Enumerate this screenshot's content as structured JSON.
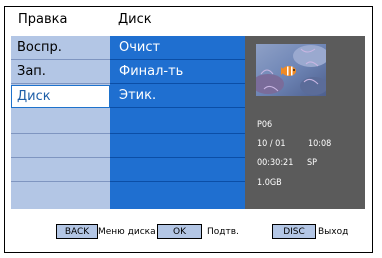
{
  "header": {
    "col1": "Правка",
    "col2": "Диск"
  },
  "left_menu": [
    "Воспр.",
    "Зап.",
    "Диск"
  ],
  "sub_menu": [
    "Очист",
    "Финал-ть",
    "Этик."
  ],
  "disc_info": {
    "title": "P06",
    "date": "10 / 01",
    "time": "10:08",
    "duration": "00:30:21",
    "mode": "SP",
    "size": "1.0GB"
  },
  "footer": {
    "back_btn": "BACK",
    "back_label": "Меню диска",
    "ok_btn": "OK",
    "ok_label": "Подтв.",
    "disc_btn": "DISC",
    "disc_label": "Выход"
  },
  "colors": {
    "left_panel": "#b3c6e5",
    "mid_panel": "#1f6fd0",
    "right_panel": "#5b5b5b",
    "selection_border": "#1e72cc"
  },
  "icons": {
    "thumbnail": "coral-reef-fish-thumbnail"
  }
}
